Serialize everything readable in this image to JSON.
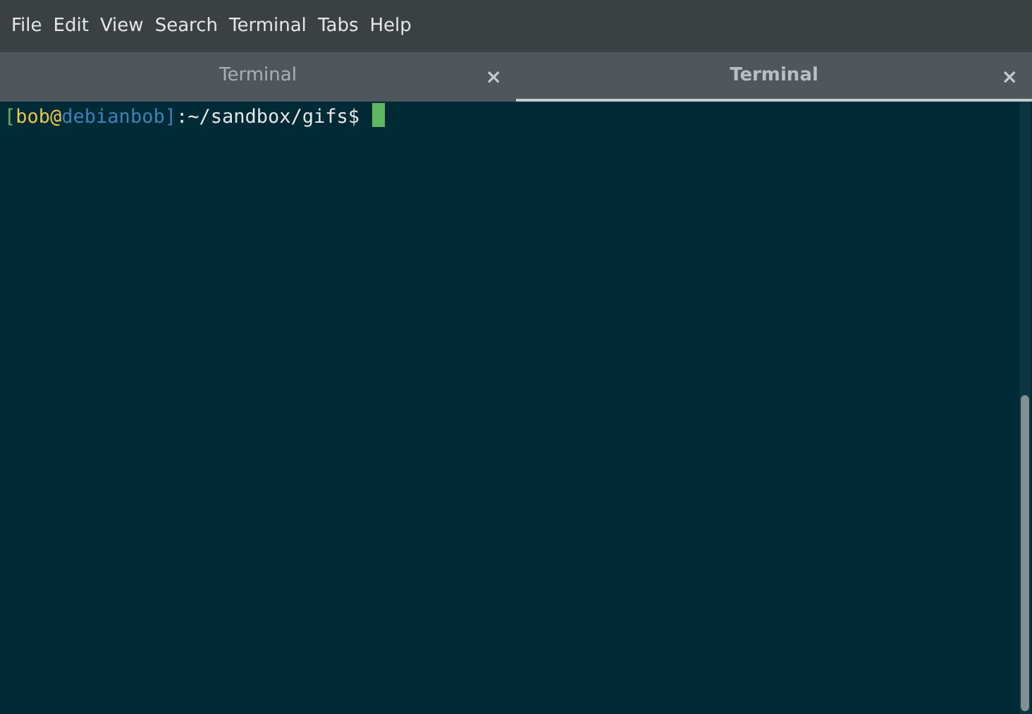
{
  "menu": [
    "File",
    "Edit",
    "View",
    "Search",
    "Terminal",
    "Tabs",
    "Help"
  ],
  "tabs": [
    {
      "label": "Terminal",
      "close": "×",
      "selected": false
    },
    {
      "label": "Terminal",
      "close": "×",
      "selected": true
    }
  ],
  "prompt": [
    {
      "text": "[",
      "color": "#5fb760"
    },
    {
      "text": "bob",
      "color": "#e8c74a"
    },
    {
      "text": "@",
      "color": "#e8c74a"
    },
    {
      "text": "debianbob",
      "color": "#3a83b8"
    },
    {
      "text": "]",
      "color": "#3a83b8"
    },
    {
      "text": ":~/sandbox/gifs$",
      "color": "#e6e6e6"
    }
  ]
}
